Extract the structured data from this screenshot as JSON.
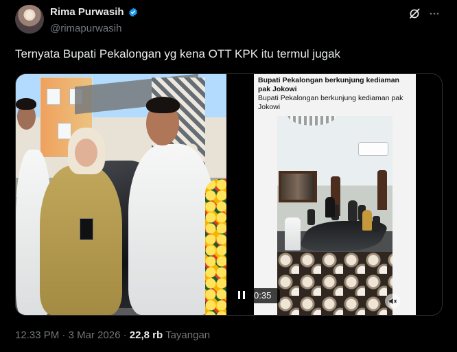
{
  "author": {
    "display_name": "Rima Purwasih",
    "handle": "@rimapurwasih",
    "avatar_icon": "profile-photo",
    "verified_icon": "verified-badge-icon",
    "verified_color": "#1d9bf0"
  },
  "header_actions": {
    "grok_icon": "grok-icon",
    "more_icon": "more-icon"
  },
  "tweet": {
    "text": "Ternyata Bupati Pekalongan yg kena OTT KPK itu termul jugak"
  },
  "media": {
    "left_photo_label": "photo",
    "video": {
      "title": "Bupati Pekalongan berkunjung kediaman pak Jokowi",
      "subtitle": "Bupati Pekalongan berkunjung kediaman pak Jokowi",
      "time": "0:35",
      "pause_icon": "pause-icon",
      "mute_icon": "mute-icon"
    }
  },
  "metadata": {
    "time": "12.33 PM",
    "separator": "·",
    "date": "3 Mar 2026",
    "views_count": "22,8 rb",
    "views_label": "Tayangan"
  },
  "colors": {
    "background": "#000000",
    "primary_text": "#e7e9ea",
    "secondary_text": "#71767b",
    "border": "#2f3336",
    "accent": "#1d9bf0"
  }
}
